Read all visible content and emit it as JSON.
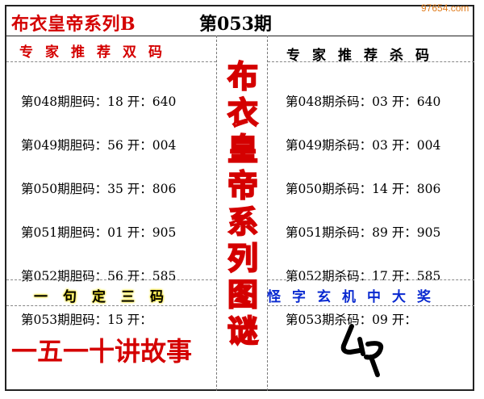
{
  "header": {
    "brand": "布衣皇帝系列B",
    "issue": "第053期",
    "watermark": "97654.com"
  },
  "left_section": {
    "title": "专家推荐双码",
    "rows": [
      "第048期胆码：18 开：640",
      "第049期胆码：56 开：004",
      "第050期胆码：35 开：806",
      "第051期胆码：01 开：905",
      "第052期胆码：56 开：585",
      "第053期胆码：15 开："
    ]
  },
  "right_section": {
    "title": "专家推荐杀码",
    "rows": [
      "第048期杀码：03 开：640",
      "第049期杀码：03 开：004",
      "第050期杀码：14 开：806",
      "第051期杀码：89 开：905",
      "第052期杀码：17 开：585",
      "第053期杀码：09 开："
    ]
  },
  "center_column": {
    "chars": [
      "布",
      "衣",
      "皇",
      "帝",
      "系",
      "列",
      "图",
      "谜"
    ]
  },
  "bottom_left": {
    "title": "一句定三码",
    "story": "一五一十讲故事"
  },
  "bottom_right": {
    "title": "怪字玄机中大奖",
    "riddle_icon": "handwritten-riddle-glyph"
  },
  "colors": {
    "red": "#d40000",
    "blue": "#0a2ad0",
    "yellow_glow": "#f5e000",
    "watermark": "#e07b1a"
  }
}
